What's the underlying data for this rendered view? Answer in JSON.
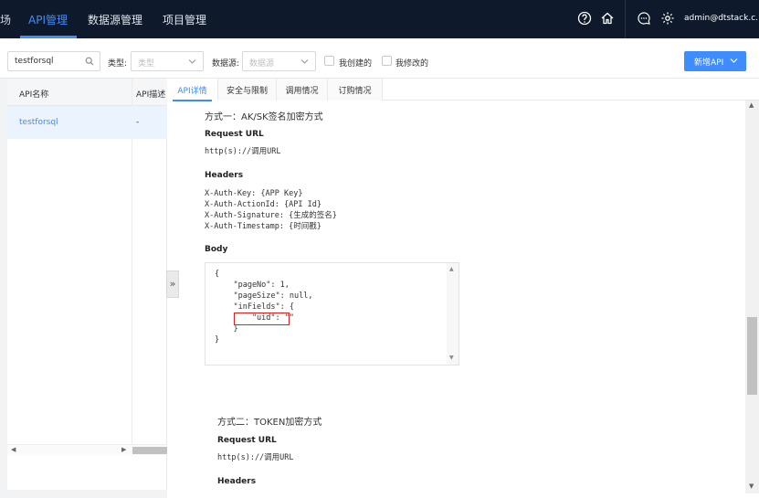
{
  "nav": {
    "left_fragment": "场",
    "items": [
      "API管理",
      "数据源管理",
      "项目管理"
    ],
    "user": "admin@dtstack.c...",
    "icons": [
      "help-icon",
      "home-icon",
      "message-icon",
      "settings-icon"
    ],
    "accent": "#3f8cff"
  },
  "filters": {
    "search_value": "testforsql",
    "type_label": "类型:",
    "type_placeholder": "类型",
    "datasource_label": "数据源:",
    "datasource_placeholder": "数据源",
    "mine_created": "我创建的",
    "mine_modified": "我修改的",
    "new_api": "新增API"
  },
  "table": {
    "columns": [
      "API名称",
      "API描述"
    ],
    "rows": [
      {
        "name": "testforsql",
        "desc": "-"
      }
    ]
  },
  "tabs": [
    "API详情",
    "安全与限制",
    "调用情况",
    "订购情况"
  ],
  "detail": {
    "method1_title": "方式一：AK/SK签名加密方式",
    "request_url_label": "Request URL",
    "request_url": "http(s)://调用URL",
    "headers_label": "Headers",
    "headers_lines": [
      "X-Auth-Key: {APP Key}",
      "X-Auth-ActionId: {API Id}",
      "X-Auth-Signature: {生成的签名}",
      "X-Auth-Timestamp: {时间戳}"
    ],
    "body_label": "Body",
    "body_lines": [
      "{",
      "    \"pageNo\": 1,",
      "    \"pageSize\": null,",
      "    \"inFields\": {",
      "        \"uid\": \"\"",
      "    }",
      "}"
    ],
    "method2_title": "方式二：TOKEN加密方式",
    "request_url_label2": "Request URL",
    "request_url2": "http(s)://调用URL",
    "headers_label2": "Headers"
  }
}
